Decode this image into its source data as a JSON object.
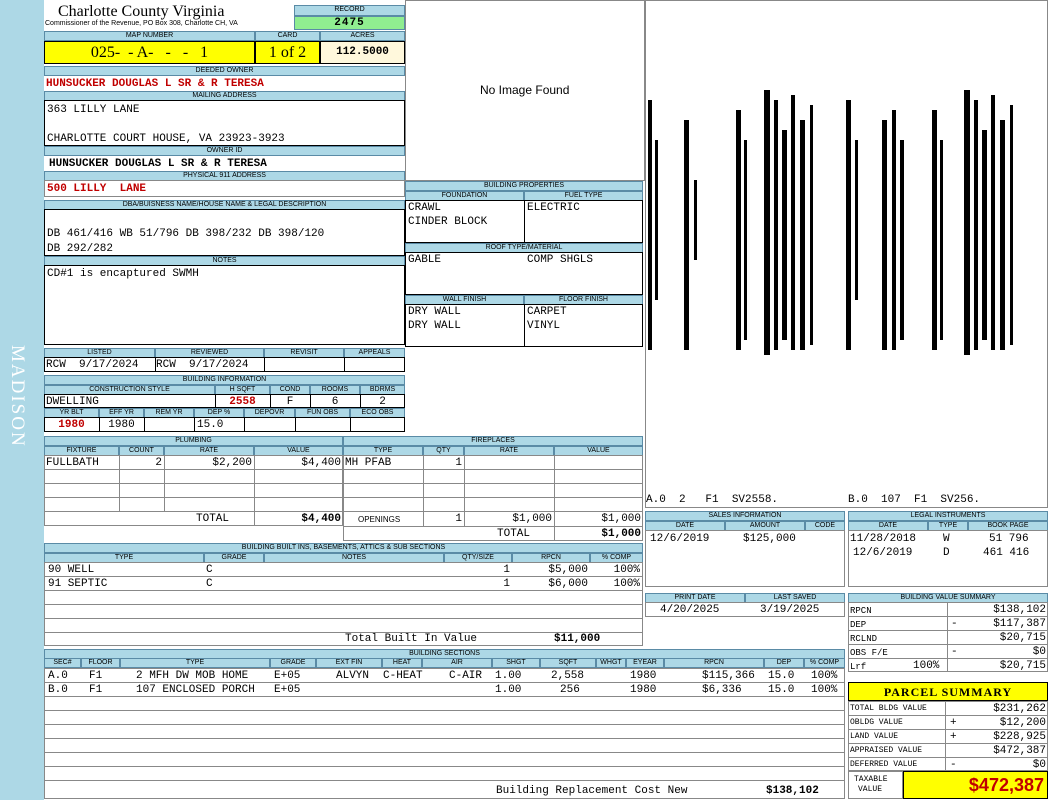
{
  "county": {
    "name": "Charlotte County Virginia",
    "sub": "Commissioner of the Revenue, PO Box 308, Charlotte CH, VA"
  },
  "sidebar": "MADISON",
  "record": {
    "label": "RECORD",
    "value": "2475"
  },
  "map": {
    "label": "MAP NUMBER",
    "value": "025-  - A-   -   -   1"
  },
  "card": {
    "label": "CARD",
    "value": "1 of 2"
  },
  "acres": {
    "label": "ACRES",
    "value": "112.5000"
  },
  "deeded": {
    "label": "DEEDED OWNER",
    "value": "HUNSUCKER DOUGLAS L SR & R TERESA"
  },
  "mailing": {
    "label": "MAILING ADDRESS",
    "line1": "363 LILLY LANE",
    "line2": "CHARLOTTE COURT HOUSE, VA 23923-3923"
  },
  "owner_id": {
    "label": "OWNER ID",
    "value": "HUNSUCKER DOUGLAS L SR & R TERESA"
  },
  "address911": {
    "label": "PHYSICAL 911 ADDRESS",
    "value": "500 LILLY  LANE"
  },
  "legal": {
    "label": "DBA/BUISNESS NAME/HOUSE NAME & LEGAL DESCRIPTION",
    "line1": "DB 461/416 WB 51/796  DB 398/232 DB 398/120",
    "line2": "DB 292/282"
  },
  "notes": {
    "label": "NOTES",
    "value": "CD#1 is encaptured SWMH"
  },
  "photo": "No Image Found",
  "bprop": {
    "label": "BUILDING PROPERTIES",
    "foundation_label": "FOUNDATION",
    "fuel_label": "FUEL TYPE",
    "found1": "CRAWL",
    "found2": "CINDER BLOCK",
    "fuel": "ELECTRIC",
    "roof_label": "ROOF TYPE/MATERIAL",
    "roof1": "GABLE",
    "roof2": "COMP SHGLS",
    "wall_label": "WALL FINISH",
    "floor_label": "FLOOR FINISH",
    "wall1": "DRY WALL",
    "wall2": "DRY WALL",
    "floor1": "CARPET",
    "floor2": "VINYL"
  },
  "sketch": {
    "a": "A.0  2   F1  SV2558.",
    "b": "B.0  107  F1  SV256."
  },
  "listed": {
    "listed_label": "LISTED",
    "reviewed_label": "REVIEWED",
    "revisit_label": "REVISIT",
    "appeals_label": "APPEALS",
    "listed": "RCW  9/17/2024",
    "reviewed": "RCW  9/17/2024"
  },
  "binfo": {
    "label": "BUILDING INFORMATION",
    "style_label": "CONSTRUCTION STYLE",
    "hsqft_label": "H SQFT",
    "cond_label": "COND",
    "rooms_label": "ROOMS",
    "bdrms_label": "BDRMS",
    "style": "DWELLING",
    "hsqft": "2558",
    "cond": "F",
    "rooms": "6",
    "bdrms": "2",
    "yrblt_label": "YR BLT",
    "effyr_label": "EFF YR",
    "remyr_label": "REM YR",
    "dep_label": "DEP %",
    "depovr_label": "DEPOVR",
    "funobs_label": "FUN OBS",
    "ecoobs_label": "ECO OBS",
    "yrblt": "1980",
    "effyr": "1980",
    "dep": "15.0"
  },
  "plumbing": {
    "label": "PLUMBING",
    "cols": [
      "FIXTURE",
      "COUNT",
      "RATE",
      "VALUE"
    ],
    "fixture": "FULLBATH",
    "count": "2",
    "rate": "$2,200",
    "value": "$4,400",
    "total_label": "TOTAL",
    "total": "$4,400"
  },
  "fireplaces": {
    "label": "FIREPLACES",
    "cols": [
      "TYPE",
      "QTY",
      "RATE",
      "VALUE"
    ],
    "type": "MH PFAB",
    "qty": "1",
    "openings_label": "OPENINGS",
    "open_qty": "1",
    "open_rate": "$1,000",
    "open_value": "$1,000",
    "total_label": "TOTAL",
    "total": "$1,000"
  },
  "sales": {
    "label": "SALES INFORMATION",
    "cols": [
      "DATE",
      "AMOUNT",
      "CODE"
    ],
    "date": "12/6/2019",
    "amount": "$125,000"
  },
  "legal_inst": {
    "label": "LEGAL INSTRUMENTS",
    "cols": [
      "DATE",
      "TYPE",
      "BOOK PAGE"
    ],
    "rows": [
      [
        "11/28/2018",
        "W",
        "51 796"
      ],
      [
        "12/6/2019",
        "D",
        "461 416"
      ]
    ]
  },
  "builtins": {
    "label": "BUILDING BUILT INS, BASEMENTS, ATTICS & SUB SECTIONS",
    "cols": [
      "TYPE",
      "GRADE",
      "NOTES",
      "QTY/SIZE",
      "RPCN",
      "% COMP"
    ],
    "rows": [
      [
        "90 WELL",
        "C",
        "1",
        "$5,000",
        "100%"
      ],
      [
        "91 SEPTIC",
        "C",
        "1",
        "$6,000",
        "100%"
      ]
    ],
    "total_label": "Total Built In Value",
    "total": "$11,000"
  },
  "dates": {
    "print_label": "PRINT DATE",
    "saved_label": "LAST SAVED",
    "print": "4/20/2025",
    "saved": "3/19/2025"
  },
  "bvs": {
    "label": "BUILDING VALUE SUMMARY",
    "rpcn_label": "RPCN",
    "rpcn": "$138,102",
    "dep_label": "DEP",
    "dep_sign": "-",
    "dep": "$117,387",
    "rclnd_label": "RCLND",
    "rclnd": "$20,715",
    "obs_label": "OBS F/E",
    "obs_sign": "-",
    "obs": "$0",
    "lrf_label": "Lrf",
    "lrf_pct": "100%",
    "lrf": "$20,715"
  },
  "sections": {
    "label": "BUILDING SECTIONS",
    "cols": [
      "SEC#",
      "FLOOR",
      "TYPE",
      "GRADE",
      "EXT FIN",
      "HEAT",
      "AIR",
      "SHGT",
      "SQFT",
      "WHGT",
      "EYEAR",
      "RPCN",
      "DEP",
      "% COMP"
    ],
    "rows": [
      [
        "A.0",
        "F1",
        "2 MFH DW MOB HOME",
        "E+05",
        "ALVYN",
        "C-HEAT",
        "C-AIR",
        "1.00",
        "2,558",
        "1980",
        "$115,366",
        "15.0",
        "100%"
      ],
      [
        "B.0",
        "F1",
        "107 ENCLOSED PORCH",
        "E+05",
        "",
        "",
        "",
        "1.00",
        "256",
        "1980",
        "$6,336",
        "15.0",
        "100%"
      ]
    ],
    "brcn_label": "Building Replacement Cost New",
    "brcn": "$138,102"
  },
  "parcel": {
    "label": "PARCEL SUMMARY",
    "rows": [
      [
        "TOTAL BLDG VALUE",
        "",
        "$231,262"
      ],
      [
        "OBLDG VALUE",
        "+",
        "$12,200"
      ],
      [
        "LAND VALUE",
        "+",
        "$228,925"
      ],
      [
        "APPRAISED VALUE",
        "",
        "$472,387"
      ],
      [
        "DEFERRED VALUE",
        "-",
        "$0"
      ]
    ],
    "taxable_label1": "TAXABLE",
    "taxable_label2": "VALUE",
    "taxable": "$472,387"
  },
  "colors": {
    "header": "#add8e6",
    "yellow": "#ffff00",
    "green": "#90ee90",
    "red": "#c00000"
  }
}
